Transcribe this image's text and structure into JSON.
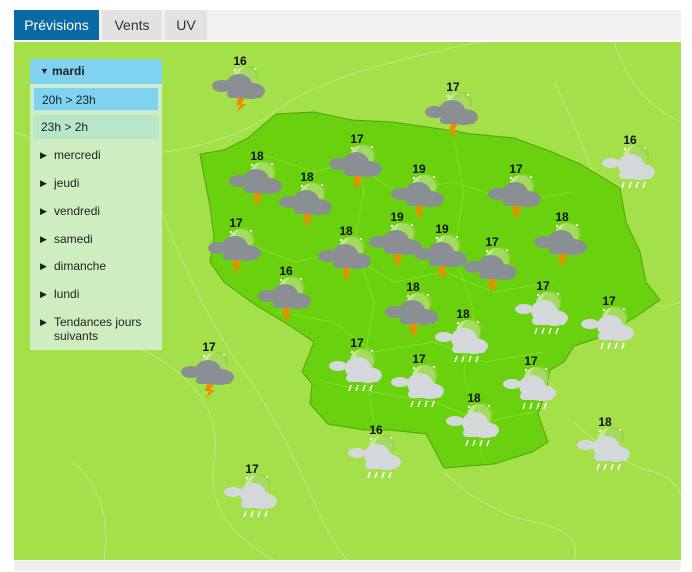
{
  "tabs": [
    {
      "label": "Prévisions",
      "active": true
    },
    {
      "label": "Vents",
      "active": false
    },
    {
      "label": "UV",
      "active": false
    }
  ],
  "menu": {
    "selected_day": "mardi",
    "time_slots": [
      {
        "label": "20h > 23h",
        "selected": true
      },
      {
        "label": "23h > 2h",
        "selected": false
      }
    ],
    "days": [
      "mercredi",
      "jeudi",
      "vendredi",
      "samedi",
      "dimanche",
      "lundi",
      "Tendances jours suivants"
    ]
  },
  "icons": {
    "storm": "night-storm-icon",
    "rain": "night-rain-icon"
  },
  "colors": {
    "map_background": "#a3e04a",
    "region": "#6ad10f",
    "active_tab": "#0a6aa3",
    "menu_highlight": "#7fd3f0",
    "lightning": "#f08a00"
  },
  "forecasts": [
    {
      "temp": "16",
      "icon": "storm"
    },
    {
      "temp": "17",
      "icon": "storm"
    },
    {
      "temp": "16",
      "icon": "rain"
    },
    {
      "temp": "17",
      "icon": "storm"
    },
    {
      "temp": "18",
      "icon": "storm"
    },
    {
      "temp": "18",
      "icon": "storm"
    },
    {
      "temp": "19",
      "icon": "storm"
    },
    {
      "temp": "17",
      "icon": "storm"
    },
    {
      "temp": "17",
      "icon": "storm"
    },
    {
      "temp": "19",
      "icon": "storm"
    },
    {
      "temp": "18",
      "icon": "storm"
    },
    {
      "temp": "19",
      "icon": "storm"
    },
    {
      "temp": "17",
      "icon": "storm"
    },
    {
      "temp": "18",
      "icon": "storm"
    },
    {
      "temp": "16",
      "icon": "storm"
    },
    {
      "temp": "18",
      "icon": "storm"
    },
    {
      "temp": "17",
      "icon": "rain"
    },
    {
      "temp": "17",
      "icon": "rain"
    },
    {
      "temp": "18",
      "icon": "rain"
    },
    {
      "temp": "17",
      "icon": "storm"
    },
    {
      "temp": "17",
      "icon": "rain"
    },
    {
      "temp": "17",
      "icon": "rain"
    },
    {
      "temp": "17",
      "icon": "rain"
    },
    {
      "temp": "18",
      "icon": "rain"
    },
    {
      "temp": "16",
      "icon": "rain"
    },
    {
      "temp": "18",
      "icon": "rain"
    },
    {
      "temp": "17",
      "icon": "rain"
    }
  ]
}
